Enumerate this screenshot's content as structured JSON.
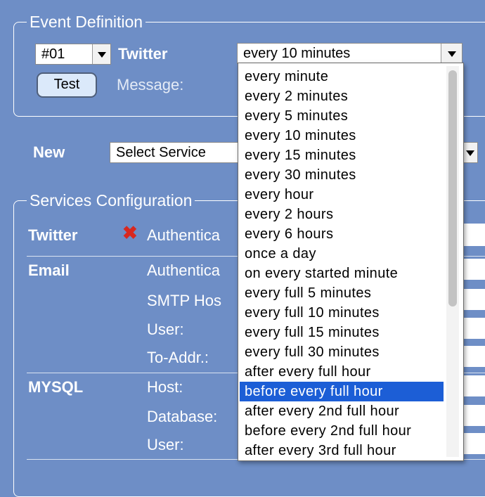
{
  "event_definition": {
    "legend": "Event Definition",
    "event_select": {
      "value": "#01"
    },
    "service_name": "Twitter",
    "test_button": "Test",
    "message_label": "Message:",
    "interval_select": {
      "value": "every 10 minutes"
    }
  },
  "new_row": {
    "label": "New",
    "service_select": {
      "value": "Select Service"
    }
  },
  "services_config": {
    "legend": "Services Configuration",
    "twitter": {
      "name": "Twitter",
      "status_icon": "red-x-icon",
      "fields": [
        "Authentica"
      ]
    },
    "email": {
      "name": "Email",
      "fields": [
        "Authentica",
        "SMTP Hos",
        "User:",
        "To-Addr.:"
      ]
    },
    "mysql": {
      "name": "MYSQL",
      "fields": [
        "Host:",
        "Database:",
        "User:"
      ]
    }
  },
  "interval_dropdown": {
    "selected_index": 16,
    "options": [
      "every minute",
      "every 2 minutes",
      "every 5 minutes",
      "every 10 minutes",
      "every 15 minutes",
      "every 30 minutes",
      "every hour",
      "every 2 hours",
      "every 6 hours",
      "once a day",
      "on every started minute",
      "every full 5 minutes",
      "every full 10 minutes",
      "every full 15 minutes",
      "every full 30 minutes",
      "after every full hour",
      "before every full hour",
      "after every 2nd full hour",
      "before every 2nd full hour",
      "after every 3rd full hour"
    ]
  },
  "colors": {
    "page_background": "#6e8ec6",
    "selection_highlight": "#1c5ed6",
    "error_icon": "#d8281f"
  }
}
